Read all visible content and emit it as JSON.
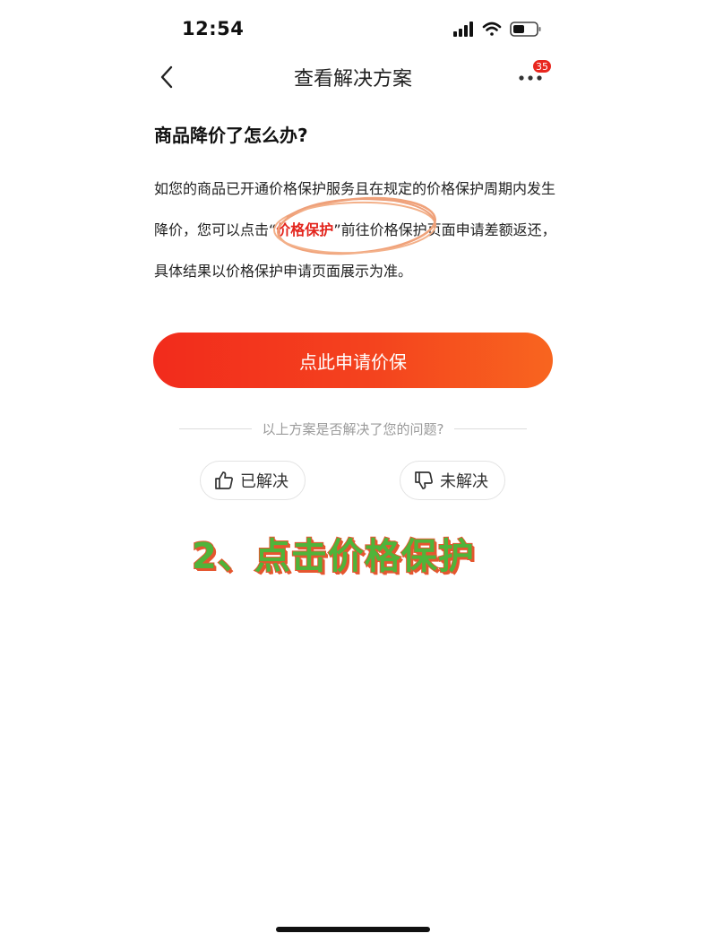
{
  "status_bar": {
    "time": "12:54",
    "icons": [
      "signal-icon",
      "wifi-icon",
      "battery-icon"
    ]
  },
  "nav": {
    "title": "查看解决方案",
    "badge_count": "35",
    "icons": [
      "back-icon",
      "more-icon"
    ]
  },
  "content": {
    "question": "商品降价了怎么办?",
    "answer_before": "如您的商品已开通价格保护服务且在规定的价格保护周期内发生降价，您可以点击“",
    "answer_highlight": "价格保护",
    "answer_after": "”前往价格保护页面申请差额返还，具体结果以价格保护申请页面展示为准。",
    "highlight_color": "#e3241c"
  },
  "apply_button": {
    "label": "点此申请价保",
    "gradient": [
      "#f22b1c",
      "#f8651f"
    ]
  },
  "feedback": {
    "question": "以上方案是否解决了您的问题?",
    "solved_label": "已解决",
    "unsolved_label": "未解决"
  },
  "annotation": {
    "caption": "2、点击价格保护",
    "caption_color": "#4fb43a",
    "outline_color": "#e5562f"
  }
}
